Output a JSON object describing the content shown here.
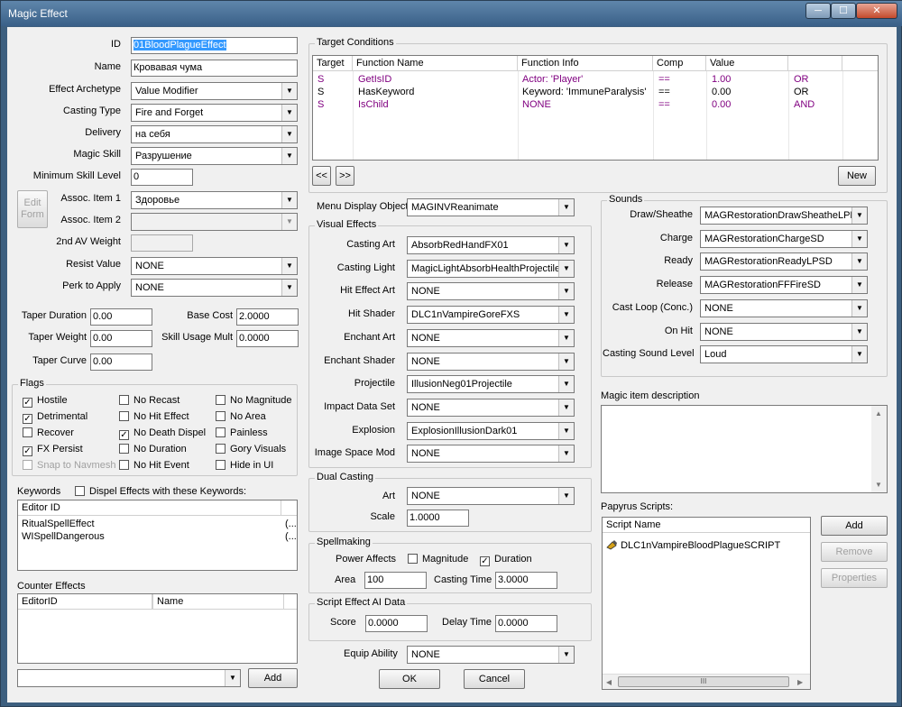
{
  "window": {
    "title": "Magic Effect",
    "min_glyph": "─",
    "max_glyph": "☐",
    "close_glyph": "✕"
  },
  "left": {
    "id_label": "ID",
    "id_value": "01BloodPlagueEffect",
    "name_label": "Name",
    "name_value": "Кровавая чума",
    "archetype_label": "Effect Archetype",
    "archetype_value": "Value Modifier",
    "casting_type_label": "Casting Type",
    "casting_type_value": "Fire and Forget",
    "delivery_label": "Delivery",
    "delivery_value": "на себя",
    "magic_skill_label": "Magic Skill",
    "magic_skill_value": "Разрушение",
    "min_skill_label": "Minimum Skill Level",
    "min_skill_value": "0",
    "edit_form_label": "Edit Form",
    "assoc1_label": "Assoc. Item 1",
    "assoc1_value": "Здоровье",
    "assoc2_label": "Assoc. Item 2",
    "assoc2_value": "",
    "second_av_label": "2nd AV Weight",
    "second_av_value": "",
    "resist_label": "Resist Value",
    "resist_value": "NONE",
    "perk_label": "Perk to Apply",
    "perk_value": "NONE",
    "taper_duration_label": "Taper Duration",
    "taper_duration_value": "0.00",
    "base_cost_label": "Base Cost",
    "base_cost_value": "2.0000",
    "taper_weight_label": "Taper Weight",
    "taper_weight_value": "0.00",
    "skill_usage_label": "Skill Usage Mult",
    "skill_usage_value": "0.0000",
    "taper_curve_label": "Taper Curve",
    "taper_curve_value": "0.00"
  },
  "flags": {
    "title": "Flags",
    "items": [
      {
        "label": "Hostile",
        "mark": "✓"
      },
      {
        "label": "No Recast",
        "mark": ""
      },
      {
        "label": "No Magnitude",
        "mark": ""
      },
      {
        "label": "Detrimental",
        "mark": "✓"
      },
      {
        "label": "No Hit Effect",
        "mark": ""
      },
      {
        "label": "No Area",
        "mark": ""
      },
      {
        "label": "Recover",
        "mark": ""
      },
      {
        "label": "No Death Dispel",
        "mark": "✓"
      },
      {
        "label": "Painless",
        "mark": ""
      },
      {
        "label": "FX Persist",
        "mark": "✓"
      },
      {
        "label": "No Duration",
        "mark": ""
      },
      {
        "label": "Gory Visuals",
        "mark": ""
      },
      {
        "label": "Snap to Navmesh",
        "mark": ""
      },
      {
        "label": "No Hit Event",
        "mark": ""
      },
      {
        "label": "Hide in UI",
        "mark": ""
      }
    ]
  },
  "keywords": {
    "label": "Keywords",
    "dispel_label": "Dispel Effects with these Keywords:",
    "col_editor_id": "Editor ID",
    "rows": [
      {
        "name": "RitualSpellEffect",
        "more": "(..."
      },
      {
        "name": "WISpellDangerous",
        "more": "(..."
      }
    ]
  },
  "counter": {
    "label": "Counter Effects",
    "col_editor_id": "EditorID",
    "col_name": "Name",
    "combo_value": "",
    "add_label": "Add"
  },
  "target": {
    "title": "Target Conditions",
    "columns": [
      "Target",
      "Function Name",
      "Function Info",
      "Comp",
      "Value",
      ""
    ],
    "rows": [
      {
        "target": "S",
        "func": "GetIsID",
        "info": "Actor: 'Player'",
        "comp": "==",
        "value": "1.00",
        "op": "OR"
      },
      {
        "target": "S",
        "func": "HasKeyword",
        "info": "Keyword: 'ImmuneParalysis'",
        "comp": "==",
        "value": "0.00",
        "op": "OR"
      },
      {
        "target": "S",
        "func": "IsChild",
        "info": "NONE",
        "comp": "==",
        "value": "0.00",
        "op": "AND"
      }
    ],
    "prev_label": "<<",
    "next_label": ">>",
    "new_label": "New"
  },
  "menu_display": {
    "label": "Menu Display Object",
    "value": "MAGINVReanimate"
  },
  "visual": {
    "title": "Visual Effects",
    "rows": [
      {
        "label": "Casting Art",
        "value": "AbsorbRedHandFX01"
      },
      {
        "label": "Casting Light",
        "value": "MagicLightAbsorbHealthProjectile"
      },
      {
        "label": "Hit Effect Art",
        "value": "NONE"
      },
      {
        "label": "Hit Shader",
        "value": "DLC1nVampireGoreFXS"
      },
      {
        "label": "Enchant Art",
        "value": "NONE"
      },
      {
        "label": "Enchant Shader",
        "value": "NONE"
      },
      {
        "label": "Projectile",
        "value": "IllusionNeg01Projectile"
      },
      {
        "label": "Impact Data Set",
        "value": "NONE"
      },
      {
        "label": "Explosion",
        "value": "ExplosionIllusionDark01"
      },
      {
        "label": "Image Space Mod",
        "value": "NONE"
      }
    ]
  },
  "dual": {
    "title": "Dual Casting",
    "art_label": "Art",
    "art_value": "NONE",
    "scale_label": "Scale",
    "scale_value": "1.0000"
  },
  "spellmaking": {
    "title": "Spellmaking",
    "power_label": "Power Affects",
    "magnitude_label": "Magnitude",
    "magnitude_mark": "",
    "duration_label": "Duration",
    "duration_mark": "✓",
    "area_label": "Area",
    "area_value": "100",
    "casting_time_label": "Casting Time",
    "casting_time_value": "3.0000"
  },
  "ai": {
    "title": "Script Effect AI Data",
    "score_label": "Score",
    "score_value": "0.0000",
    "delay_label": "Delay Time",
    "delay_value": "0.0000"
  },
  "equip": {
    "label": "Equip Ability",
    "value": "NONE"
  },
  "ok_label": "OK",
  "cancel_label": "Cancel",
  "sounds": {
    "title": "Sounds",
    "rows": [
      {
        "label": "Draw/Sheathe",
        "value": "MAGRestorationDrawSheatheLPM:"
      },
      {
        "label": "Charge",
        "value": "MAGRestorationChargeSD"
      },
      {
        "label": "Ready",
        "value": "MAGRestorationReadyLPSD"
      },
      {
        "label": "Release",
        "value": "MAGRestorationFFFireSD"
      },
      {
        "label": "Cast Loop (Conc.)",
        "value": "NONE"
      },
      {
        "label": "On Hit",
        "value": "NONE"
      },
      {
        "label": "Casting Sound Level",
        "value": "Loud"
      }
    ]
  },
  "description": {
    "label": "Magic item description",
    "value": ""
  },
  "papyrus": {
    "label": "Papyrus Scripts:",
    "col_script": "Script Name",
    "scripts": [
      "DLC1nVampireBloodPlagueSCRIPT"
    ],
    "add_label": "Add",
    "remove_label": "Remove",
    "properties_label": "Properties",
    "hscroll_grip": "III"
  }
}
